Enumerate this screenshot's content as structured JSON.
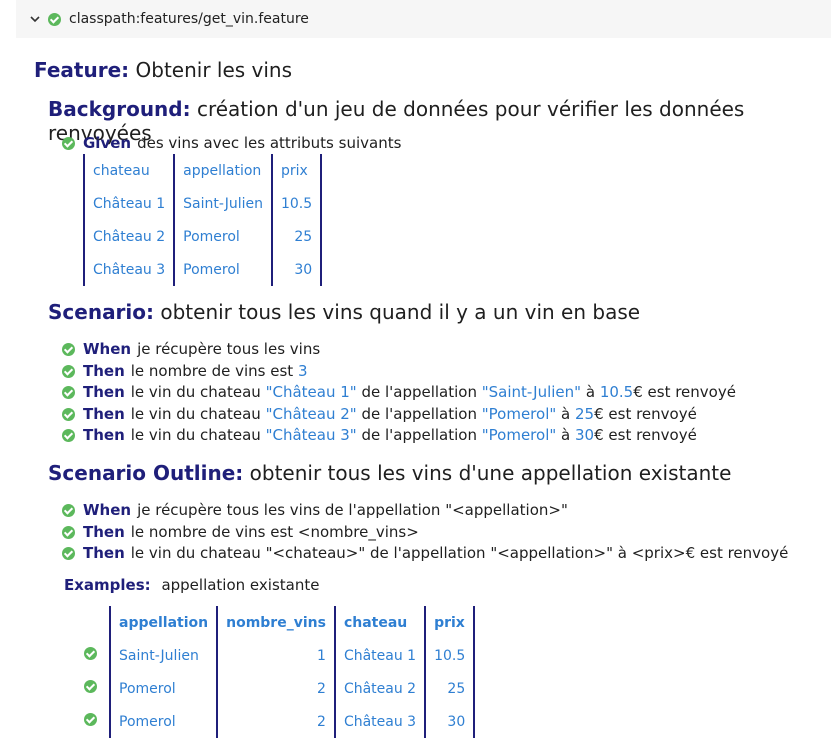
{
  "header": {
    "path": "classpath:features/get_vin.feature"
  },
  "feature": {
    "keyword": "Feature:",
    "name": "Obtenir les vins"
  },
  "background": {
    "keyword": "Background:",
    "name": "création d'un jeu de données pour vérifier les données renvoyées",
    "step": {
      "keyword": "Given",
      "text": "des vins avec les attributs suivants"
    },
    "table": {
      "header": [
        "chateau",
        "appellation",
        "prix"
      ],
      "rows": [
        [
          "Château 1",
          "Saint-Julien",
          "10.5"
        ],
        [
          "Château 2",
          "Pomerol",
          "25"
        ],
        [
          "Château 3",
          "Pomerol",
          "30"
        ]
      ]
    }
  },
  "scenario": {
    "keyword": "Scenario:",
    "name": "obtenir tous les vins quand il y a un vin en base",
    "steps": [
      {
        "keyword": "When",
        "parts": [
          "je récupère tous les vins"
        ]
      },
      {
        "keyword": "Then",
        "parts": [
          "le nombre de vins est ",
          "3"
        ]
      },
      {
        "keyword": "Then",
        "parts": [
          "le vin du chateau ",
          "\"Château 1\"",
          " de l'appellation ",
          "\"Saint-Julien\"",
          " à ",
          "10.5",
          "€ est renvoyé"
        ]
      },
      {
        "keyword": "Then",
        "parts": [
          "le vin du chateau ",
          "\"Château 2\"",
          " de l'appellation ",
          "\"Pomerol\"",
          " à ",
          "25",
          "€ est renvoyé"
        ]
      },
      {
        "keyword": "Then",
        "parts": [
          "le vin du chateau ",
          "\"Château 3\"",
          " de l'appellation ",
          "\"Pomerol\"",
          " à ",
          "30",
          "€ est renvoyé"
        ]
      }
    ]
  },
  "outline": {
    "keyword": "Scenario Outline:",
    "name": "obtenir tous les vins d'une appellation existante",
    "steps": [
      {
        "keyword": "When",
        "text": "je récupère tous les vins de l'appellation \"<appellation>\""
      },
      {
        "keyword": "Then",
        "text": "le nombre de vins est <nombre_vins>"
      },
      {
        "keyword": "Then",
        "text": "le vin du chateau \"<chateau>\" de l'appellation \"<appellation>\" à <prix>€ est renvoyé"
      }
    ],
    "examples": {
      "keyword": "Examples:",
      "name": "appellation existante",
      "header": [
        "appellation",
        "nombre_vins",
        "chateau",
        "prix"
      ],
      "rows": [
        [
          "Saint-Julien",
          "1",
          "Château 1",
          "10.5"
        ],
        [
          "Pomerol",
          "2",
          "Château 2",
          "25"
        ],
        [
          "Pomerol",
          "2",
          "Château 3",
          "30"
        ]
      ]
    }
  },
  "colors": {
    "keyword": "#1f1f7a",
    "value": "#2f7fd2",
    "passed": "#5cb85c",
    "header_bg": "#f6f6f6"
  }
}
